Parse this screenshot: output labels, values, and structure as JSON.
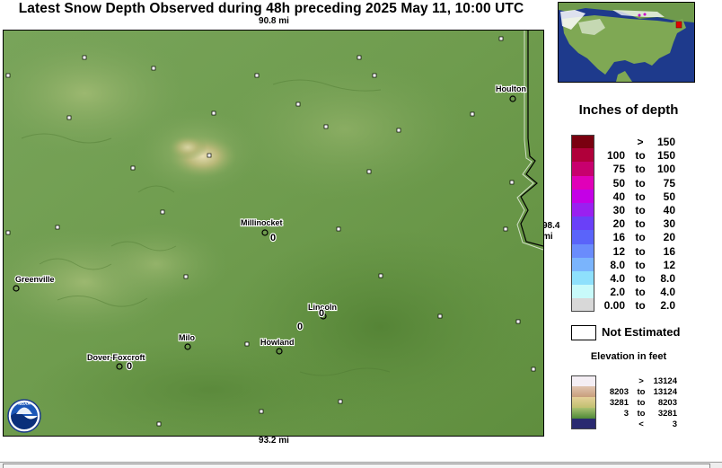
{
  "title": "Latest Snow Depth Observed during 48h preceding 2025 May 11, 10:00 UTC",
  "scale": {
    "top": "90.8 mi",
    "bottom": "93.2 mi",
    "right_value": "98.4",
    "right_unit": "mi"
  },
  "stations": [
    {
      "name": "Houlton",
      "depth": ""
    },
    {
      "name": "Millinocket",
      "depth": "0"
    },
    {
      "name": "Greenville",
      "depth": ""
    },
    {
      "name": "Lincoln",
      "depth": "0"
    },
    {
      "name": "Milo",
      "depth": ""
    },
    {
      "name": "Howland",
      "depth": ""
    },
    {
      "name": "Dover-Foxcroft",
      "depth": "0"
    }
  ],
  "extra_depth_values": [
    "0"
  ],
  "noaa_logo_text": "NOAA",
  "legend": {
    "title": "Inches of depth",
    "rows": [
      {
        "lo": "",
        "to": ">",
        "hi": "150",
        "color": "#7a0010"
      },
      {
        "lo": "100",
        "to": "to",
        "hi": "150",
        "color": "#b0003a"
      },
      {
        "lo": "75",
        "to": "to",
        "hi": "100",
        "color": "#c8006e"
      },
      {
        "lo": "50",
        "to": "to",
        "hi": "75",
        "color": "#e000b8"
      },
      {
        "lo": "40",
        "to": "to",
        "hi": "50",
        "color": "#c400e6"
      },
      {
        "lo": "30",
        "to": "to",
        "hi": "40",
        "color": "#9a20f0"
      },
      {
        "lo": "20",
        "to": "to",
        "hi": "30",
        "color": "#6a40f8"
      },
      {
        "lo": "16",
        "to": "to",
        "hi": "20",
        "color": "#5a64fa"
      },
      {
        "lo": "12",
        "to": "to",
        "hi": "16",
        "color": "#6a8cfc"
      },
      {
        "lo": "8.0",
        "to": "to",
        "hi": "12",
        "color": "#7ab4fc"
      },
      {
        "lo": "4.0",
        "to": "to",
        "hi": "8.0",
        "color": "#8ee0fc"
      },
      {
        "lo": "2.0",
        "to": "to",
        "hi": "4.0",
        "color": "#c8fafa"
      },
      {
        "lo": "0.00",
        "to": "to",
        "hi": "2.0",
        "color": "#d8d8d8"
      }
    ],
    "not_estimated": "Not Estimated"
  },
  "elevation": {
    "title": "Elevation in feet",
    "rows": [
      {
        "lo": "",
        "to": ">",
        "hi": "13124",
        "color": "#f4eef4"
      },
      {
        "lo": "8203",
        "to": "to",
        "hi": "13124",
        "color": "#d4aa8c"
      },
      {
        "lo": "3281",
        "to": "to",
        "hi": "8203",
        "color": "#dccc88"
      },
      {
        "lo": "3",
        "to": "to",
        "hi": "3281",
        "color": "#6c9a48"
      },
      {
        "lo": "",
        "to": "<",
        "hi": "3",
        "color": "#2a2a70"
      }
    ]
  }
}
